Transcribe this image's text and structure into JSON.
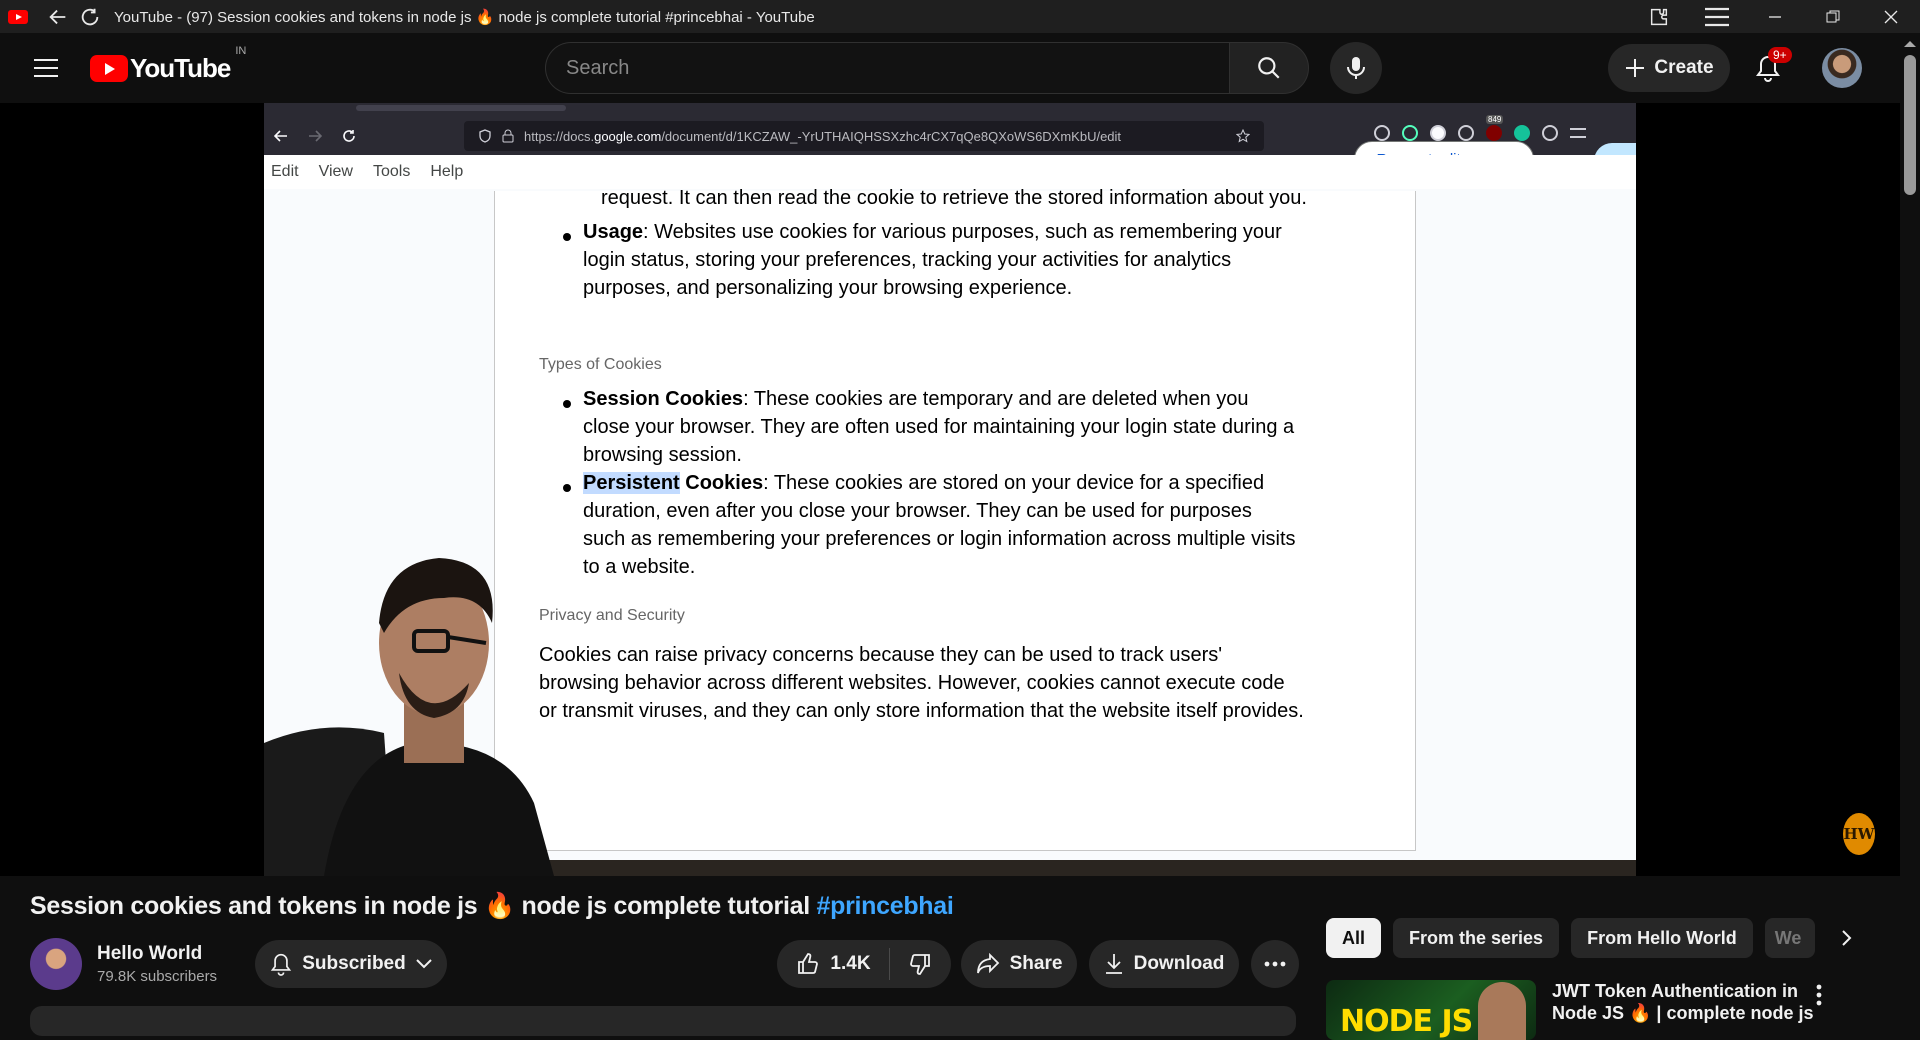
{
  "window": {
    "title": "YouTube - (97) Session cookies and tokens in node js 🔥 node js complete tutorial #princebhai - YouTube"
  },
  "masthead": {
    "logo_text": "YouTube",
    "country_code": "IN",
    "search_placeholder": "Search",
    "create_label": "Create",
    "notification_count": "9+"
  },
  "inner_browser": {
    "url_prefix": "https://docs.",
    "url_domain": "google.com",
    "url_path": "/document/d/1KCZAW_-YrUTHAIQHSSXzhc4rCX7qQe8QXoWS6DXmKbU/edit",
    "ext_badge": "849",
    "docs_menu": [
      "Edit",
      "View",
      "Tools",
      "Help"
    ],
    "request_access": "Request edit access"
  },
  "document": {
    "cut_line": "request. It can then read the cookie to retrieve the stored information about you.",
    "usage_term": "Usage",
    "usage_lines": [
      ": Websites use cookies for various purposes, such as remembering your",
      "login status, storing your preferences, tracking your activities for analytics",
      "purposes, and personalizing your browsing experience."
    ],
    "types_heading": "Types of Cookies",
    "session_term": "Session Cookies",
    "session_lines": [
      ": These cookies are temporary and are deleted when you",
      "close your browser. They are often used for maintaining your login state during a",
      "browsing session."
    ],
    "persistent_term_hl": "Persistent",
    "persistent_term_rest": " Cookies",
    "persistent_lines": [
      ": These cookies are stored on your device for a specified",
      "duration, even after you close your browser. They can be used for purposes",
      "such as remembering your preferences or login information across multiple visits",
      "to a website."
    ],
    "privacy_heading": "Privacy and Security",
    "privacy_lines": [
      "Cookies can raise privacy concerns because they can be used to track users'",
      "browsing behavior across different websites. However, cookies cannot execute code",
      "or transmit viruses, and they can only store information that the website itself provides."
    ]
  },
  "watermark": "HW",
  "video": {
    "title_main": "Session cookies and tokens in node js 🔥 node js complete tutorial ",
    "title_hashtag": "#princebhai",
    "channel_name": "Hello World",
    "subscribers": "79.8K subscribers",
    "subscribed_label": "Subscribed",
    "likes": "1.4K",
    "share_label": "Share",
    "download_label": "Download"
  },
  "sidebar": {
    "chips": [
      "All",
      "From the series",
      "From Hello World",
      "We"
    ],
    "rec_thumb_label": "NODE JS",
    "rec_title": "JWT Token Authentication in Node JS 🔥 | complete node js"
  },
  "colors": {
    "youtube_red": "#ff0000",
    "link_blue": "#3ea6ff",
    "docs_blue": "#0b57d0",
    "highlight": "#c2dbff"
  }
}
